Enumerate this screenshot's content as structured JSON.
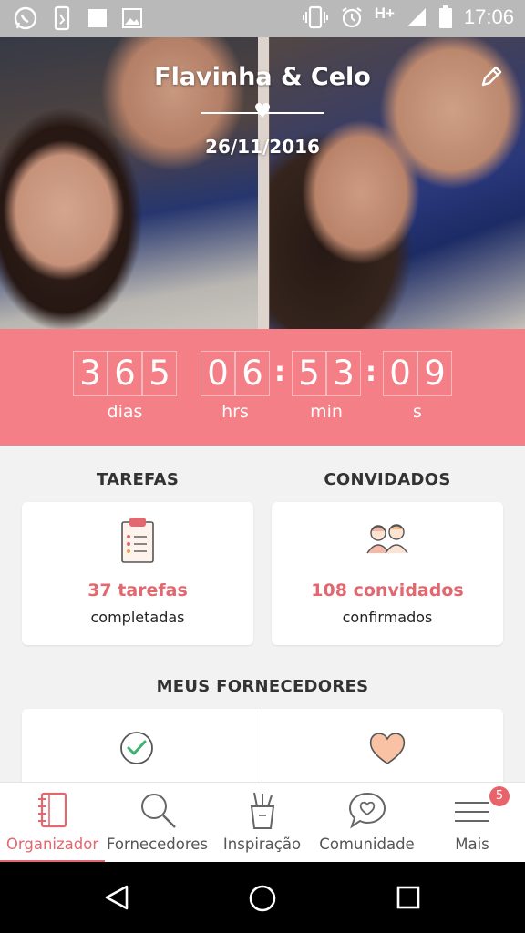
{
  "status_bar": {
    "time": "17:06",
    "network": "H+",
    "left_icons": [
      "whatsapp-icon",
      "phone-alert-icon",
      "square-icon",
      "gallery-icon"
    ],
    "right_icons": [
      "vibrate-icon",
      "alarm-icon",
      "signal-icon",
      "battery-icon"
    ]
  },
  "hero": {
    "couple_name": "Flavinha & Celo",
    "wedding_date": "26/11/2016",
    "icons": [
      "heart-icon",
      "edit-icon"
    ]
  },
  "countdown": {
    "days": [
      "3",
      "6",
      "5"
    ],
    "hours": [
      "0",
      "6"
    ],
    "minutes": [
      "5",
      "3"
    ],
    "seconds": [
      "0",
      "9"
    ],
    "labels": {
      "days": "dias",
      "hours": "hrs",
      "minutes": "min",
      "seconds": "s"
    }
  },
  "tasks": {
    "title": "TAREFAS",
    "count": "37 tarefas",
    "subtitle": "completadas",
    "icon": "clipboard-icon"
  },
  "guests": {
    "title": "CONVIDADOS",
    "count": "108 convidados",
    "subtitle": "confirmados",
    "icon": "couple-icon"
  },
  "vendors": {
    "title": "MEUS FORNECEDORES",
    "icons": [
      "check-circle-icon",
      "heart-outline-icon"
    ]
  },
  "bottom_nav": {
    "items": [
      {
        "label": "Organizador",
        "icon": "notebook-icon",
        "active": true
      },
      {
        "label": "Fornecedores",
        "icon": "search-icon",
        "active": false
      },
      {
        "label": "Inspiração",
        "icon": "pencil-cup-icon",
        "active": false
      },
      {
        "label": "Comunidade",
        "icon": "chat-heart-icon",
        "active": false
      },
      {
        "label": "Mais",
        "icon": "menu-icon",
        "active": false,
        "badge": "5"
      }
    ]
  },
  "colors": {
    "accent": "#f47f86",
    "accent_text": "#e2686f",
    "status_bar": "#b9b9b9"
  }
}
